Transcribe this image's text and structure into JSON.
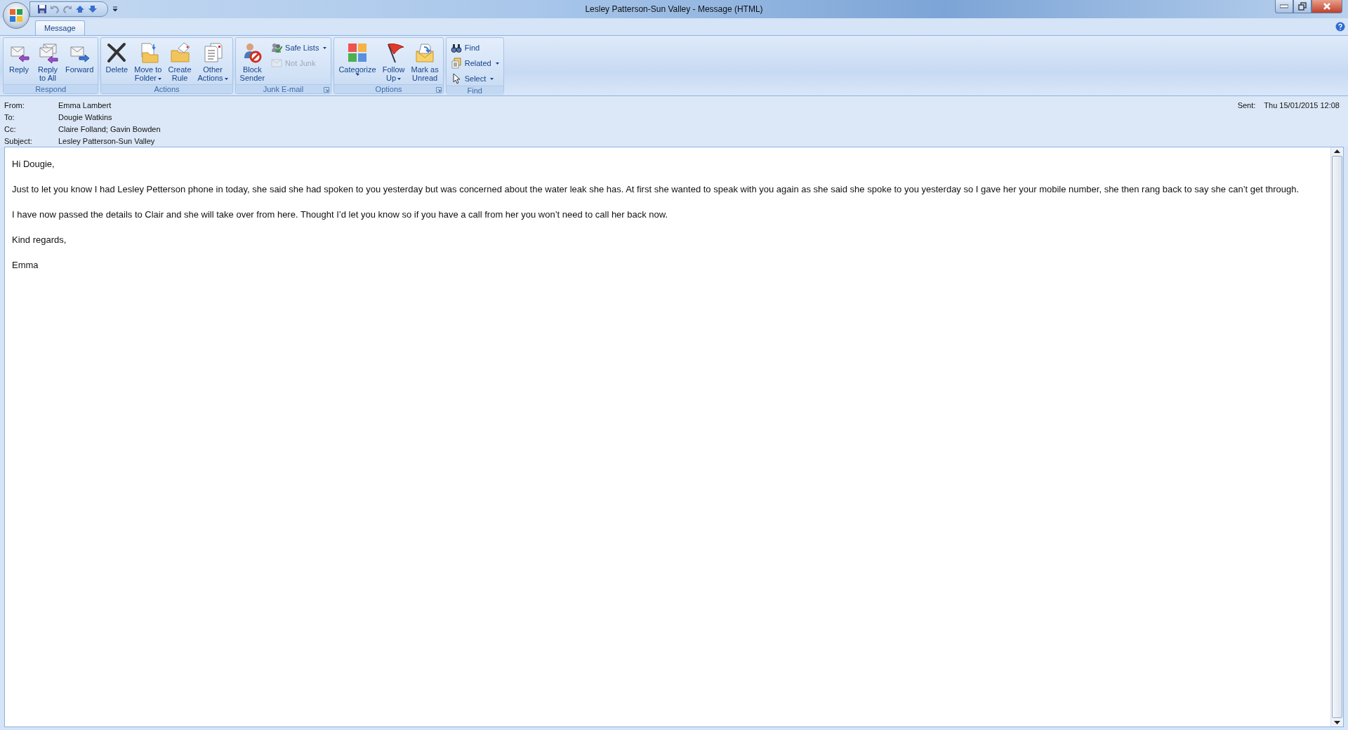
{
  "window": {
    "title": "Lesley Patterson-Sun Valley - Message (HTML)"
  },
  "tabs": [
    {
      "label": "Message",
      "selected": true
    }
  ],
  "ribbon": {
    "groups": [
      {
        "label": "Respond",
        "launcher": false,
        "buttons": [
          {
            "kind": "large",
            "label": "Reply",
            "has_menu": false,
            "disabled": false
          },
          {
            "kind": "large",
            "label": "Reply\nto All",
            "has_menu": false,
            "disabled": false
          },
          {
            "kind": "large",
            "label": "Forward",
            "has_menu": false,
            "disabled": false
          }
        ]
      },
      {
        "label": "Actions",
        "launcher": false,
        "buttons": [
          {
            "kind": "large",
            "label": "Delete",
            "has_menu": false,
            "disabled": false
          },
          {
            "kind": "large",
            "label": "Move to\nFolder",
            "has_menu": true,
            "disabled": false
          },
          {
            "kind": "large",
            "label": "Create\nRule",
            "has_menu": false,
            "disabled": false
          },
          {
            "kind": "large",
            "label": "Other\nActions",
            "has_menu": true,
            "disabled": false
          }
        ]
      },
      {
        "label": "Junk E-mail",
        "launcher": true,
        "buttons": [
          {
            "kind": "large",
            "label": "Block\nSender",
            "has_menu": false,
            "disabled": false
          },
          {
            "kind": "small",
            "label": "Safe Lists",
            "has_menu": true,
            "disabled": false
          },
          {
            "kind": "small",
            "label": "Not Junk",
            "has_menu": false,
            "disabled": true
          }
        ]
      },
      {
        "label": "Options",
        "launcher": true,
        "buttons": [
          {
            "kind": "large",
            "label": "Categorize",
            "has_menu": true,
            "disabled": false
          },
          {
            "kind": "large",
            "label": "Follow\nUp",
            "has_menu": true,
            "disabled": false
          },
          {
            "kind": "large",
            "label": "Mark as\nUnread",
            "has_menu": false,
            "disabled": false
          }
        ]
      },
      {
        "label": "Find",
        "launcher": false,
        "buttons": [
          {
            "kind": "small",
            "label": "Find",
            "has_menu": false,
            "disabled": false
          },
          {
            "kind": "small",
            "label": "Related",
            "has_menu": true,
            "disabled": false
          },
          {
            "kind": "small",
            "label": "Select",
            "has_menu": true,
            "disabled": false
          }
        ]
      }
    ]
  },
  "header": {
    "fields": [
      {
        "label": "From:",
        "value": "Emma Lambert"
      },
      {
        "label": "To:",
        "value": "Dougie Watkins"
      },
      {
        "label": "Cc:",
        "value": "Claire Folland; Gavin Bowden"
      },
      {
        "label": "Subject:",
        "value": "Lesley Patterson-Sun Valley"
      }
    ],
    "sent": {
      "label": "Sent:",
      "value": "Thu 15/01/2015 12:08"
    }
  },
  "body": {
    "paragraphs": [
      "Hi Dougie,",
      "Just to let you know I  had Lesley Petterson phone in today, she said she had spoken to you yesterday but was concerned about the water leak she has. At first she wanted to speak with you again as she said she spoke to you yesterday so I gave her your mobile number, she then rang back to say she can’t get through.",
      "I have now passed the details to Clair and she will take over from here. Thought I’d let you know so if you have a call from her you won’t need to call her back now.",
      "Kind regards,",
      "Emma"
    ]
  }
}
